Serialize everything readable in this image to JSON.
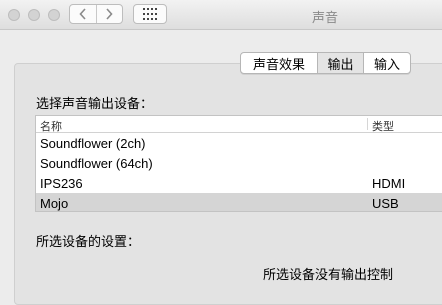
{
  "window": {
    "title": "声音",
    "toolbar": {
      "back_icon": "chevron-left-icon",
      "forward_icon": "chevron-right-icon",
      "grid_icon": "show-all-grid-icon"
    }
  },
  "tabs": [
    {
      "label": "声音效果",
      "selected": false
    },
    {
      "label": "输出",
      "selected": true
    },
    {
      "label": "输入",
      "selected": false
    }
  ],
  "output": {
    "select_label": "选择声音输出设备：",
    "columns": {
      "name": "名称",
      "type": "类型"
    },
    "devices": [
      {
        "name": "Soundflower (2ch)",
        "type": ""
      },
      {
        "name": "Soundflower (64ch)",
        "type": ""
      },
      {
        "name": "IPS236",
        "type": "HDMI"
      },
      {
        "name": "Mojo",
        "type": "USB",
        "selected": true
      }
    ],
    "settings_label": "所选设备的设置：",
    "no_controls_text": "所选设备没有输出控制"
  },
  "colors": {
    "window_bg": "#ececec",
    "selected_row": "#d5d5d5"
  }
}
